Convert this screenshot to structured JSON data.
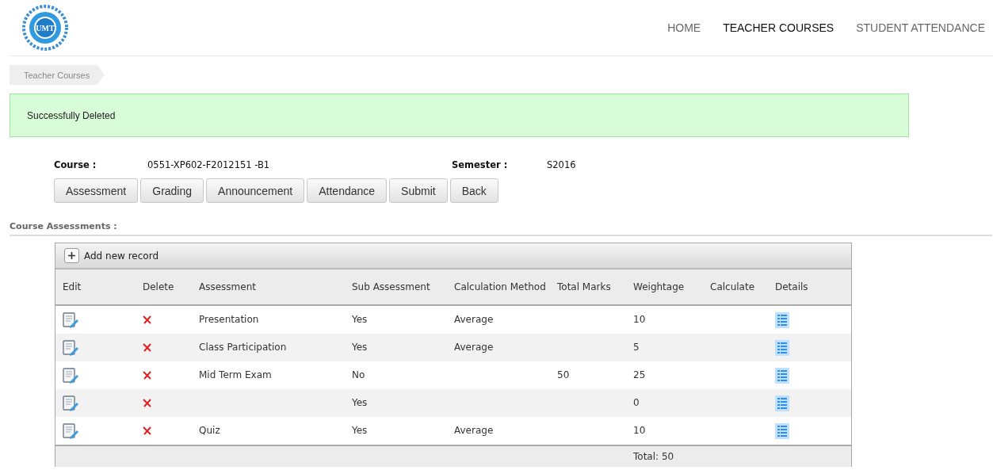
{
  "logo": {
    "text": "UMT"
  },
  "nav": [
    {
      "label": "HOME",
      "selected": false
    },
    {
      "label": "TEACHER COURSES",
      "selected": true
    },
    {
      "label": "STUDENT ATTENDANCE",
      "selected": false
    }
  ],
  "breadcrumb": [
    "Teacher Courses"
  ],
  "alert": "Successfully Deleted",
  "course": {
    "label": "Course :",
    "value": "0551-XP602-F2012151 -B1",
    "semester_label": "Semester :",
    "semester_value": "S2016"
  },
  "buttons": [
    "Assessment",
    "Grading",
    "Announcement",
    "Attendance",
    "Submit",
    "Back"
  ],
  "section_title": "Course Assessments :",
  "grid": {
    "add_label": "Add new record",
    "columns": [
      "Edit",
      "Delete",
      "Assessment",
      "Sub Assessment",
      "Calculation Method",
      "Total Marks",
      "Weightage",
      "Calculate",
      "Details"
    ],
    "rows": [
      {
        "assessment": "Presentation",
        "sub_assessment": "Yes",
        "calculation_method": "Average",
        "total_marks": "",
        "weightage": "10"
      },
      {
        "assessment": "Class Participation",
        "sub_assessment": "Yes",
        "calculation_method": "Average",
        "total_marks": "",
        "weightage": "5"
      },
      {
        "assessment": "Mid Term Exam",
        "sub_assessment": "No",
        "calculation_method": "",
        "total_marks": "50",
        "weightage": "25"
      },
      {
        "assessment": "",
        "sub_assessment": "Yes",
        "calculation_method": "",
        "total_marks": "",
        "weightage": "0"
      },
      {
        "assessment": "Quiz",
        "sub_assessment": "Yes",
        "calculation_method": "Average",
        "total_marks": "",
        "weightage": "10"
      }
    ],
    "footer_total": "Total: 50"
  }
}
